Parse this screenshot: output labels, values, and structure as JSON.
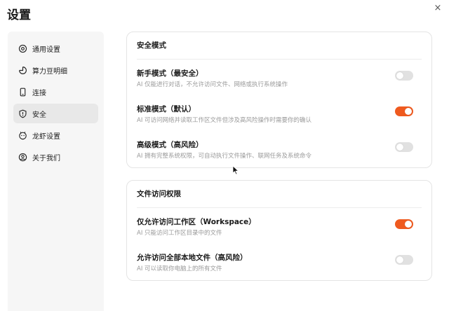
{
  "window": {
    "title": "设置",
    "close_glyph": "×"
  },
  "colors": {
    "accent": "#ef5a1f",
    "toggle_off": "#e1e1e1",
    "active_nav": "#e8e8e8"
  },
  "sidebar": {
    "items": [
      {
        "label": "通用设置",
        "icon": "gear-icon",
        "active": false
      },
      {
        "label": "算力豆明细",
        "icon": "pie-chart-icon",
        "active": false
      },
      {
        "label": "连接",
        "icon": "phone-icon",
        "active": false
      },
      {
        "label": "安全",
        "icon": "shield-icon",
        "active": true
      },
      {
        "label": "龙虾设置",
        "icon": "lobster-icon",
        "active": false
      },
      {
        "label": "关于我们",
        "icon": "user-circle-icon",
        "active": false
      }
    ]
  },
  "security_mode": {
    "title": "安全模式",
    "options": [
      {
        "title": "新手模式（最安全）",
        "desc": "AI 仅能进行对话，不允许访问文件、网络或执行系统操作",
        "enabled": false
      },
      {
        "title": "标准模式（默认）",
        "desc": "AI 可访问网络并读取工作区文件但涉及高风险操作时需要你的确认",
        "enabled": true
      },
      {
        "title": "高级模式（高风险）",
        "desc": "AI 拥有完整系统权限，可自动执行文件操作、联网任务及系统命令",
        "enabled": false
      }
    ]
  },
  "file_access": {
    "title": "文件访问权限",
    "options": [
      {
        "title": "仅允许访问工作区（Workspace）",
        "desc": "AI 只能访问工作区目录中的文件",
        "enabled": true
      },
      {
        "title": "允许访问全部本地文件（高风险）",
        "desc": "AI 可以读取你电脑上的所有文件",
        "enabled": false
      }
    ]
  }
}
